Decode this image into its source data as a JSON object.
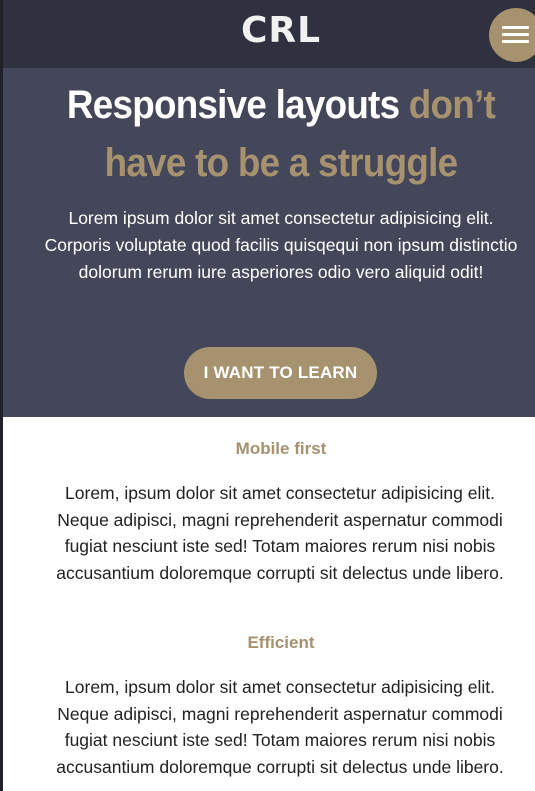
{
  "header": {
    "logo": "CRL",
    "menu_label": "menu"
  },
  "hero": {
    "title_white": "Responsive layouts ",
    "title_accent": "don’t have to be a struggle",
    "text": "Lorem ipsum dolor sit amet consectetur adipisicing elit. Corporis voluptate quod facilis quisqequi non ipsum distinctio dolorum rerum iure asperiores odio vero aliquid odit!",
    "cta_label": "I WANT TO LEARN"
  },
  "features": [
    {
      "title": "Mobile first",
      "text": "Lorem, ipsum dolor sit amet consectetur adipisicing elit. Neque adipisci, magni reprehenderit aspernatur commodi fugiat nesciunt iste sed! Totam maiores rerum nisi nobis accusantium doloremque corrupti sit delectus unde libero."
    },
    {
      "title": "Efficient",
      "text": "Lorem, ipsum dolor sit amet consectetur adipisicing elit. Neque adipisci, magni reprehenderit aspernatur commodi fugiat nesciunt iste sed! Totam maiores rerum nisi nobis accusantium doloremque corrupti sit delectus unde libero."
    }
  ],
  "colors": {
    "header_bg": "#2f313f",
    "hero_bg": "#444659",
    "accent": "#a6926f",
    "text_dark": "#222222"
  },
  "icons": {
    "menu": "hamburger-menu-icon"
  }
}
